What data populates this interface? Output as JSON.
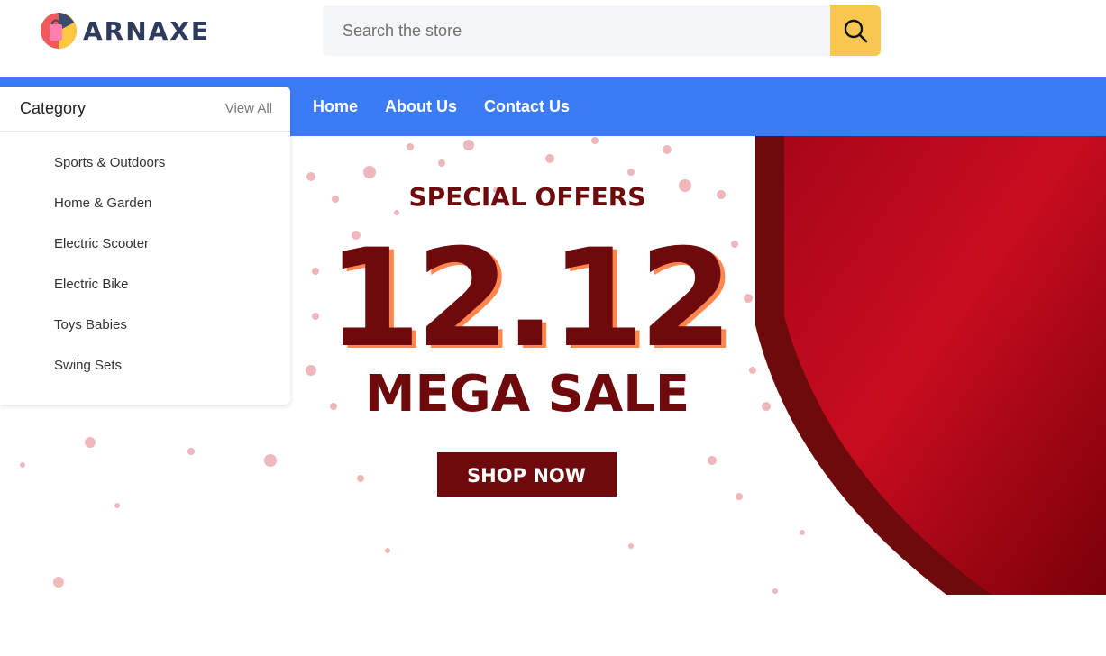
{
  "header": {
    "logo_text": "ARNAXE",
    "logo_icon": "shopping-bag-icon"
  },
  "search": {
    "placeholder": "Search the store",
    "value": "",
    "button_icon": "search-icon"
  },
  "nav": {
    "links": [
      {
        "label": "Home"
      },
      {
        "label": "About Us"
      },
      {
        "label": "Contact Us"
      }
    ]
  },
  "category": {
    "title": "Category",
    "view_all": "View All",
    "items": [
      {
        "label": "Sports & Outdoors"
      },
      {
        "label": "Home & Garden"
      },
      {
        "label": "Electric Scooter"
      },
      {
        "label": "Electric Bike"
      },
      {
        "label": "Toys Babies"
      },
      {
        "label": "Swing Sets"
      }
    ]
  },
  "banner": {
    "kicker": "SPECIAL OFFERS",
    "headline": "12.12",
    "subheadline": "MEGA SALE",
    "cta": "SHOP NOW"
  },
  "colors": {
    "nav_bg": "#3b7bf6",
    "search_button": "#f9c74f",
    "banner_red": "#c40016",
    "banner_dark": "#6e0a0c"
  }
}
